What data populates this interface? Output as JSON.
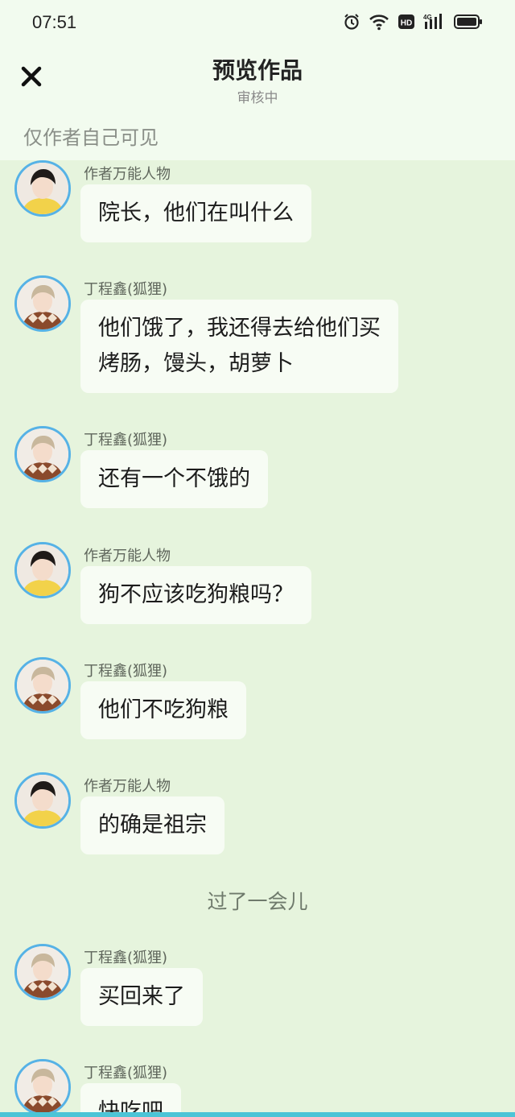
{
  "status_bar": {
    "time": "07:51",
    "net": "4G",
    "hd": "HD"
  },
  "header": {
    "title": "预览作品",
    "subtitle": "审核中",
    "visibility": "仅作者自己可见"
  },
  "avatars": {
    "author": {
      "kind": "yellow-shirt",
      "color": "#f2d24a"
    },
    "ding": {
      "kind": "argyle-sweater",
      "color": "#8a4a2c"
    }
  },
  "messages": [
    {
      "sender": "作者万能人物",
      "lines": [
        "院长，他们在叫什么"
      ]
    },
    {
      "sender": "丁程鑫(狐狸)",
      "lines": [
        "他们饿了，我还得去给他们买",
        "烤肠，馒头，胡萝卜"
      ]
    },
    {
      "sender": "丁程鑫(狐狸)",
      "lines": [
        "还有一个不饿的"
      ]
    },
    {
      "sender": "作者万能人物",
      "lines": [
        "狗不应该吃狗粮吗？"
      ]
    },
    {
      "sender": "丁程鑫(狐狸)",
      "lines": [
        "他们不吃狗粮"
      ]
    },
    {
      "sender": "作者万能人物",
      "lines": [
        "的确是祖宗"
      ]
    },
    {
      "divider": "过了一会儿"
    },
    {
      "sender": "丁程鑫(狐狸)",
      "lines": [
        "买回来了"
      ]
    },
    {
      "sender": "丁程鑫(狐狸)",
      "lines": [
        "快吃吧"
      ]
    }
  ]
}
